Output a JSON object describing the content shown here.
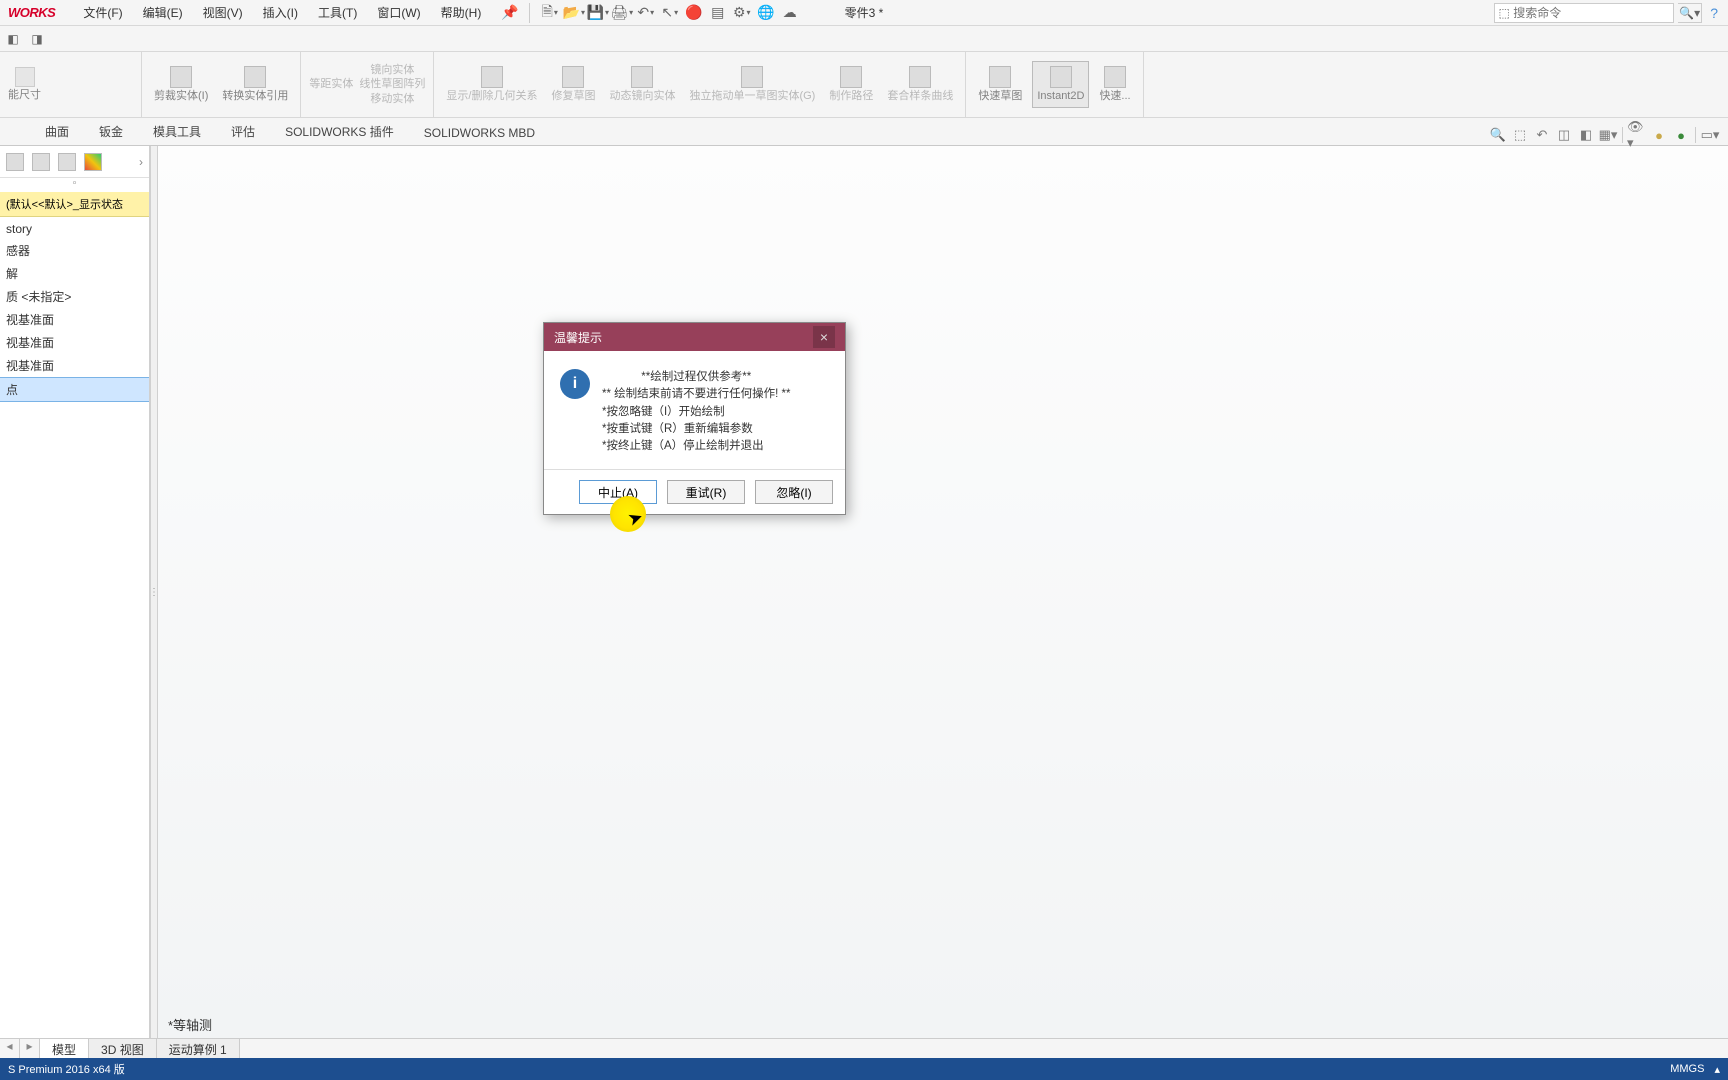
{
  "app": {
    "logo": "WORKS",
    "doc_title": "零件3 *"
  },
  "menu": [
    "文件(F)",
    "编辑(E)",
    "视图(V)",
    "插入(I)",
    "工具(T)",
    "窗口(W)",
    "帮助(H)"
  ],
  "search": {
    "placeholder": "搜索命令"
  },
  "ribbon": {
    "smart_dim": "能尺寸",
    "trim": "剪裁实体(I)",
    "convert": "转换实体引用",
    "mirror": "镜向实体",
    "linear_pattern": "线性草图阵列",
    "move": "移动实体",
    "offset": "等距实体",
    "show_rel": "显示/删除几何关系",
    "repair": "修复草图",
    "dyn_mirror": "动态镜向实体",
    "drag": "独立拖动单一草图实体(G)",
    "path": "制作路径",
    "fit_spline": "套合样条曲线",
    "rapid_sketch": "快速草图",
    "instant2d": "Instant2D",
    "rapid": "快速..."
  },
  "tabs": [
    "",
    "曲面",
    "钣金",
    "模具工具",
    "评估",
    "SOLIDWORKS 插件",
    "SOLIDWORKS MBD"
  ],
  "tree": {
    "state": "(默认<<默认>_显示状态",
    "nodes": [
      "story",
      "感器",
      "解",
      "质 <未指定>",
      "视基准面",
      "视基准面",
      "视基准面",
      "点"
    ]
  },
  "view_name": "*等轴测",
  "bottom_tabs": {
    "model": "模型",
    "view3d": "3D 视图",
    "motion": "运动算例 1"
  },
  "status": {
    "version": "S Premium 2016 x64 版",
    "units": "MMGS"
  },
  "dialog": {
    "title": "温馨提示",
    "lines": [
      "**绘制过程仅供参考**",
      "** 绘制结束前请不要进行任何操作! **",
      "*按忽略键（I）开始绘制",
      "*按重试键（R）重新编辑参数",
      "*按终止键（A）停止绘制并退出"
    ],
    "abort": "中止(A)",
    "retry": "重试(R)",
    "ignore": "忽略(I)",
    "close": "×",
    "info": "i"
  },
  "help": "?"
}
